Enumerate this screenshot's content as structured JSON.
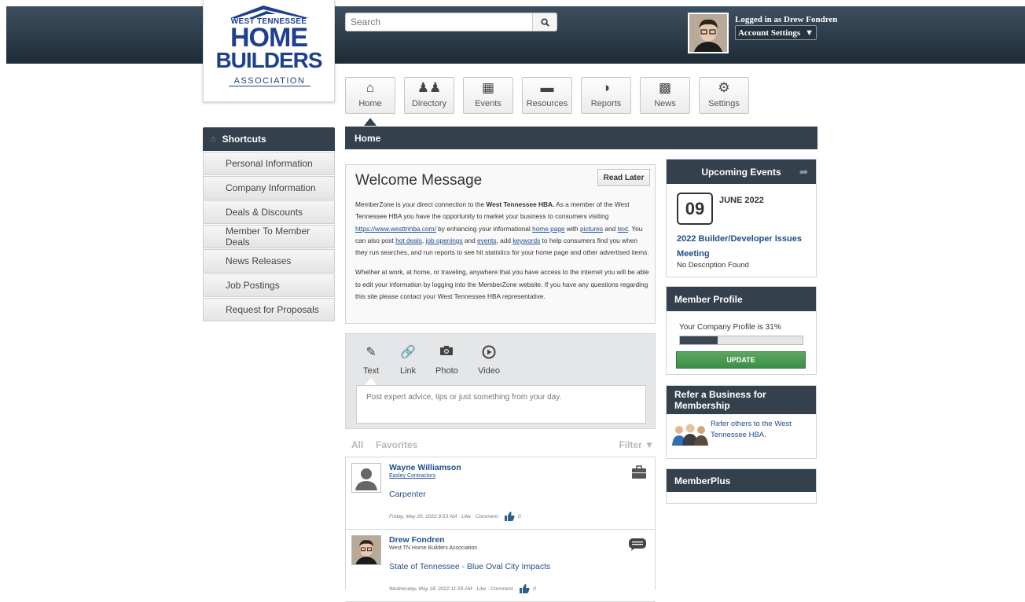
{
  "header": {
    "logo_top": "WEST TENNESSEE",
    "logo_home": "HOME",
    "logo_builders": "BUILDERS",
    "logo_association": "ASSOCIATION",
    "search_placeholder": "Search",
    "logged_in_text": "Logged in as Drew Fondren",
    "account_settings_label": "Account Settings"
  },
  "nav": {
    "tabs": [
      {
        "label": "Home",
        "icon": "home-icon"
      },
      {
        "label": "Directory",
        "icon": "people-icon"
      },
      {
        "label": "Events",
        "icon": "calendar-icon"
      },
      {
        "label": "Resources",
        "icon": "folder-icon"
      },
      {
        "label": "Reports",
        "icon": "pie-chart-icon"
      },
      {
        "label": "News",
        "icon": "buildings-icon"
      },
      {
        "label": "Settings",
        "icon": "gear-icon"
      }
    ]
  },
  "sidebar": {
    "heading": "Shortcuts",
    "items": [
      {
        "label": "Personal Information"
      },
      {
        "label": "Company Information"
      },
      {
        "label": "Deals & Discounts"
      },
      {
        "label": "Member To Member Deals"
      },
      {
        "label": "News Releases"
      },
      {
        "label": "Job Postings"
      },
      {
        "label": "Request for Proposals"
      }
    ]
  },
  "main": {
    "page_title": "Home",
    "welcome": {
      "title": "Welcome Message",
      "read_later": "Read Later",
      "p1_a": "MemberZone is your direct connection to the ",
      "p1_bold": "West Tennessee HBA.",
      "p1_b": "  As a member of the West Tennessee HBA you have the opportunity to market your business to consumers visiting ",
      "p1_link_url": "https://www.westtnhba.com/",
      "p1_c": " by enhancing your informational ",
      "p1_link_home": "home page",
      "p1_d": " with ",
      "p1_link_pictures": "pictures",
      "p1_e": " and ",
      "p1_link_text": "text",
      "p1_f": ".  You can also post ",
      "p1_link_hotdeals": "hot deals",
      "p1_g": ", ",
      "p1_link_jobs": "job openings",
      "p1_h": " and ",
      "p1_link_events": "events",
      "p1_i": ", add ",
      "p1_link_keywords": "keywords",
      "p1_j": " to help consumers find you when they run searches, and run reports to see hit statistics for your home page and other advertised items.",
      "p2": "Whether at work, at home, or traveling, anywhere that you have access to the internet you will be able to edit your information by logging into the MemberZone website.  If you have any questions regarding this site please contact your West Tennessee HBA representative."
    },
    "composer": {
      "tabs": [
        {
          "label": "Text",
          "icon": "pencil-icon"
        },
        {
          "label": "Link",
          "icon": "link-icon"
        },
        {
          "label": "Photo",
          "icon": "camera-icon"
        },
        {
          "label": "Video",
          "icon": "play-icon"
        }
      ],
      "placeholder": "Post expert advice, tips or just something from your day."
    },
    "filters": {
      "all": "All",
      "favorites": "Favorites",
      "filter": "Filter ▼"
    },
    "posts": [
      {
        "author": "Wayne Williamson",
        "company": "Easley Contractors",
        "title": "Carpenter",
        "meta": "Friday, May 20, 2022 9:53 AM · Like · Comment ·",
        "likes": "0",
        "type_icon": "briefcase-icon"
      },
      {
        "author": "Drew Fondren",
        "company": "West TN Home Builders Association",
        "title": "State of Tennessee - Blue Oval City Impacts",
        "meta": "Wednesday, May 18, 2022 11:59 AM · Like · Comment ·",
        "likes": "0",
        "type_icon": "status-update-icon"
      }
    ]
  },
  "right": {
    "events": {
      "heading": "Upcoming Events",
      "day": "09",
      "month_year": "JUNE 2022",
      "title": "2022 Builder/Developer Issues Meeting",
      "description": "No Description Found"
    },
    "profile": {
      "heading": "Member Profile",
      "status": "Your Company Profile is 31%",
      "progress_pct": 31,
      "update_label": "UPDATE"
    },
    "refer": {
      "heading": "Refer a Business for Membership",
      "text": "Refer others to the West Tennessee HBA."
    },
    "memberplus": {
      "heading": "MemberPlus"
    }
  },
  "colors": {
    "header_bg": "#2a3845",
    "brand_blue": "#1f3f8f",
    "link": "#1f4e8c",
    "update_green": "#4a9b52"
  }
}
